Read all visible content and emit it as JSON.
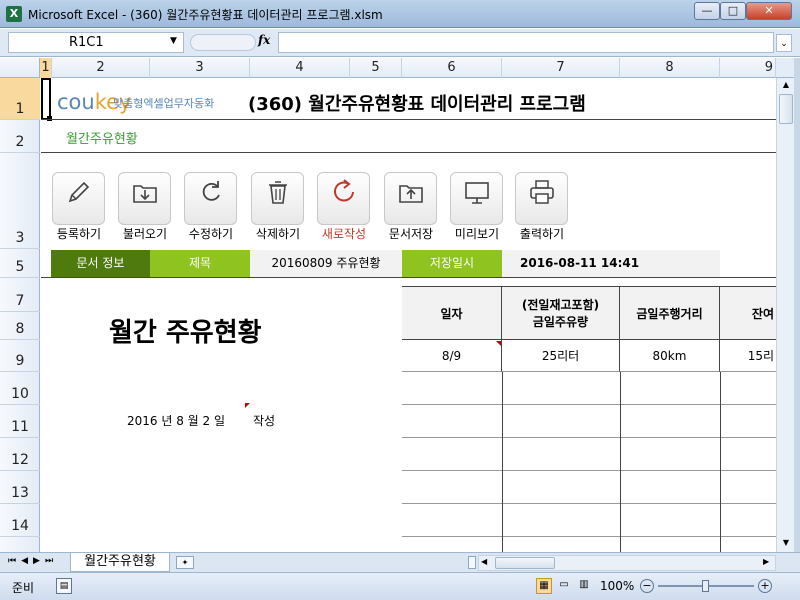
{
  "window": {
    "title": "Microsoft Excel - (360) 월간주유현황표 데이터관리 프로그램.xlsm",
    "app_icon": "X",
    "minimize": "—",
    "restore": "□",
    "close": "✕"
  },
  "formula_bar": {
    "name_box": "R1C1",
    "fx": "fx",
    "formula": ""
  },
  "columns": [
    "1",
    "2",
    "3",
    "4",
    "5",
    "6",
    "7",
    "8",
    "9"
  ],
  "rows": [
    "1",
    "2",
    "3",
    "5",
    "7",
    "8",
    "9",
    "10",
    "11",
    "12",
    "13",
    "14"
  ],
  "header": {
    "logo_cou": "cou",
    "logo_key": "key",
    "logo_tagline": "맞춤형엑셀업무자동화",
    "program_title": "(360) 월간주유현황표 데이터관리 프로그램",
    "sheet_subtitle": "월간주유현황"
  },
  "toolbar": [
    {
      "label": "등록하기",
      "icon": "pencil-icon"
    },
    {
      "label": "불러오기",
      "icon": "download-folder-icon"
    },
    {
      "label": "수정하기",
      "icon": "refresh-icon"
    },
    {
      "label": "삭제하기",
      "icon": "trash-icon"
    },
    {
      "label": "새로작성",
      "icon": "new-icon",
      "color": "#c0392b"
    },
    {
      "label": "문서저장",
      "icon": "upload-folder-icon"
    },
    {
      "label": "미리보기",
      "icon": "monitor-icon"
    },
    {
      "label": "출력하기",
      "icon": "printer-icon"
    }
  ],
  "info_bar": {
    "doc_info_label": "문서 정보",
    "title_label": "제목",
    "title_value": "20160809 주유현황",
    "saved_label": "저장일시",
    "saved_value": "2016-08-11 14:41"
  },
  "document": {
    "heading": "월간 주유현황",
    "date_line": "2016 년 8 월 2 일",
    "written": "작성"
  },
  "table": {
    "headers": [
      "일자",
      "(전일재고포함)\n금일주유량",
      "금일주행거리",
      "잔여"
    ],
    "rows": [
      [
        "8/9",
        "25리터",
        "80km",
        "15리"
      ]
    ]
  },
  "sheet_tab": "월간주유현황",
  "status": {
    "ready": "준비",
    "zoom": "100%"
  },
  "colors": {
    "green_dark": "#4f7a0e",
    "green_light": "#8fc31f",
    "title_green": "#3a9b35"
  }
}
